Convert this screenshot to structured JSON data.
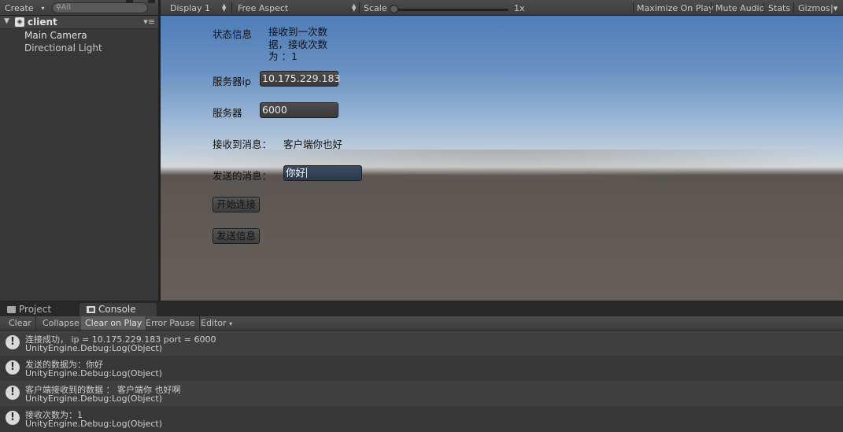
{
  "hierarchy": {
    "create_label": "Create",
    "search_placeholder": "All",
    "scene_name": "client",
    "items": [
      {
        "label": "Main Camera"
      },
      {
        "label": "Directional Light"
      }
    ]
  },
  "game_toolbar": {
    "display": "Display 1",
    "aspect": "Free Aspect",
    "scale_label": "Scale",
    "scale_value": "1x",
    "maximize_on_play": "Maximize On Play",
    "mute_audio": "Mute Audio",
    "stats": "Stats",
    "gizmos": "Gizmos"
  },
  "game_ui": {
    "status_label": "状态信息",
    "status_value": "接收到一次数据，接收次数为 ：1",
    "server_ip_label": "服务器ip",
    "server_ip_value": "10.175.229.183",
    "server_port_label": "服务器",
    "server_port_value": "6000",
    "received_label": "接收到消息：",
    "received_value": "客户端你也好",
    "send_label": "发送的消息：",
    "send_value": "你好",
    "connect_button": "开始连接",
    "send_button": "发送信息"
  },
  "console": {
    "tabs": [
      {
        "label": "Project"
      },
      {
        "label": "Console"
      }
    ],
    "toolbar": {
      "clear": "Clear",
      "collapse": "Collapse",
      "clear_on_play": "Clear on Play",
      "error_pause": "Error Pause",
      "editor": "Editor"
    },
    "logs": [
      {
        "message": "连接成功， ip = 10.175.229.183 port = 6000",
        "source": "UnityEngine.Debug:Log(Object)"
      },
      {
        "message": "发送的数据为：你好",
        "source": "UnityEngine.Debug:Log(Object)"
      },
      {
        "message": "客户端接收到的数据 ： 客户端你 也好啊",
        "source": "UnityEngine.Debug:Log(Object)"
      },
      {
        "message": "接收次数为：1",
        "source": "UnityEngine.Debug:Log(Object)"
      }
    ]
  }
}
